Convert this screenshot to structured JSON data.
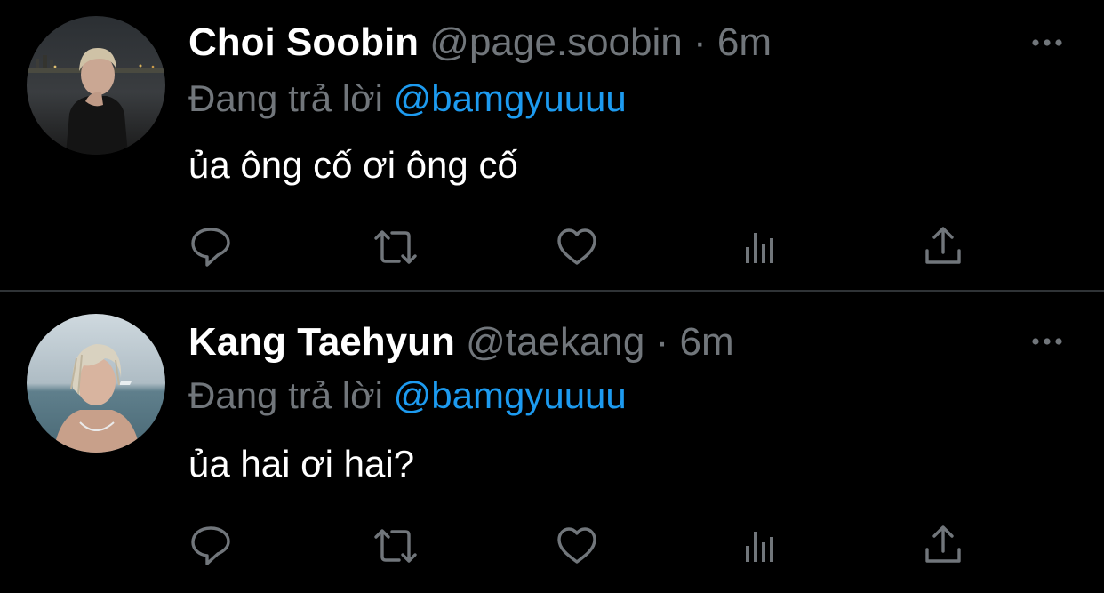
{
  "colors": {
    "background": "#000000",
    "name": "#ffffff",
    "secondary_text": "#71767b",
    "mention": "#1d9bf0",
    "divider": "#2f3336"
  },
  "tweets": [
    {
      "display_name": "Choi Soobin",
      "handle": "@page.soobin",
      "separator": "·",
      "time": "6m",
      "replying_prefix": "Đang trả lời",
      "replying_to": "@bamgyuuuu",
      "text": "ủa ông cố ơi ông cố",
      "icons": [
        "reply-icon",
        "retweet-icon",
        "like-icon",
        "views-icon",
        "share-icon",
        "more-icon"
      ]
    },
    {
      "display_name": "Kang Taehyun",
      "handle": "@taekang",
      "separator": "·",
      "time": "6m",
      "replying_prefix": "Đang trả lời",
      "replying_to": "@bamgyuuuu",
      "text": "ủa hai ơi hai?",
      "icons": [
        "reply-icon",
        "retweet-icon",
        "like-icon",
        "views-icon",
        "share-icon",
        "more-icon"
      ]
    }
  ]
}
